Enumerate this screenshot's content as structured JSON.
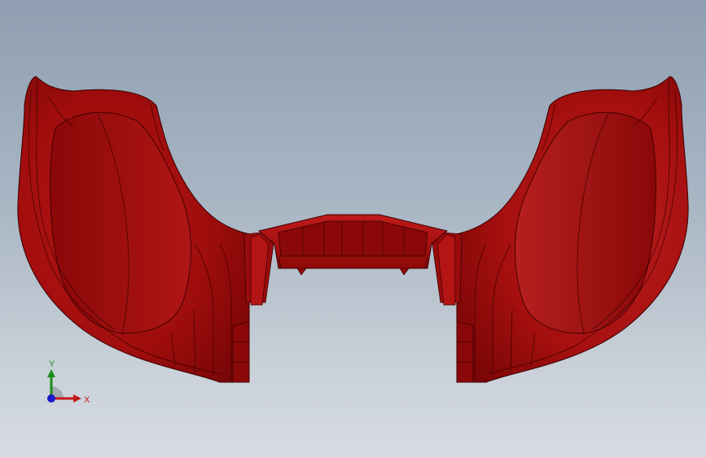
{
  "viewport": {
    "background_top": "#8f9fb1",
    "background_bottom": "#d7dce2"
  },
  "model": {
    "part_color": "#a80e0e",
    "edge_color": "#3a0000"
  },
  "triad": {
    "y_label": "Y",
    "x_label": "X",
    "y_color": "#1a8c1a",
    "x_color": "#c21a1a",
    "z_color": "#1a1acc"
  }
}
